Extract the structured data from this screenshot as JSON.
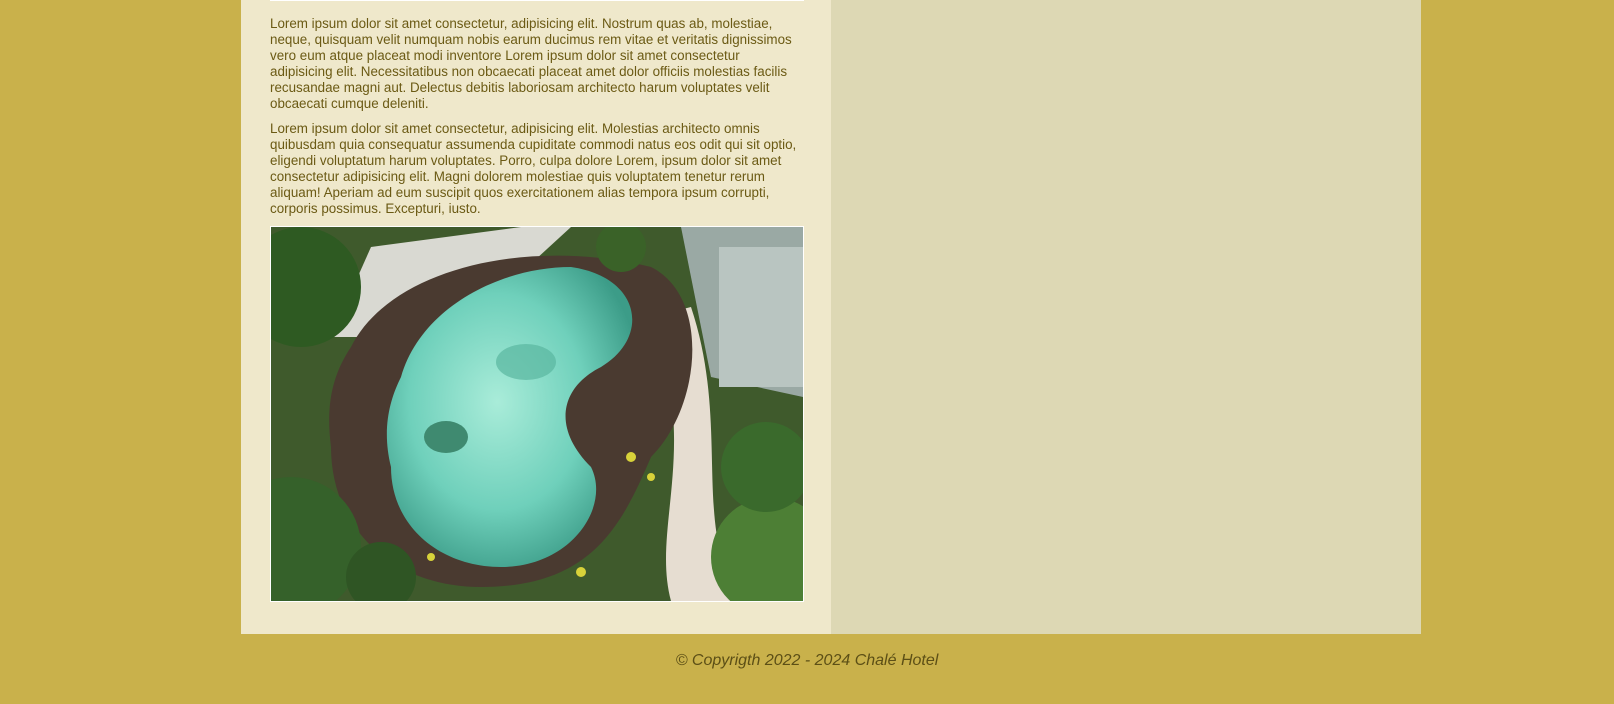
{
  "content": {
    "paragraphs": [
      "Lorem ipsum dolor sit amet consectetur, adipisicing elit. Nostrum quas ab, molestiae, neque, quisquam velit numquam nobis earum ducimus rem vitae et veritatis dignissimos vero eum atque placeat modi inventore Lorem ipsum dolor sit amet consectetur adipisicing elit. Necessitatibus non obcaecati placeat amet dolor officiis molestias facilis recusandae magni aut. Delectus debitis laboriosam architecto harum voluptates velit obcaecati cumque deleniti.",
      "Lorem ipsum dolor sit amet consectetur, adipisicing elit. Molestias architecto omnis quibusdam quia consequatur assumenda cupiditate commodi natus eos odit qui sit optio, eligendi voluptatum harum voluptates. Porro, culpa dolore Lorem, ipsum dolor sit amet consectetur adipisicing elit. Magni dolorem molestiae quis voluptatem tenetur rerum aliquam! Aperiam ad eum suscipit quos exercitationem alias tempora ipsum corrupti, corporis possimus. Excepturi, iusto."
    ]
  },
  "footer": {
    "copyright": "© Copyrigth 2022 - 2024 Chalé Hotel"
  },
  "colors": {
    "page_background": "#c9b14b",
    "main_column": "#efe8cb",
    "side_column": "#ddd8b4",
    "text": "#6b5a14",
    "pool_water": "#7fd8c4"
  }
}
